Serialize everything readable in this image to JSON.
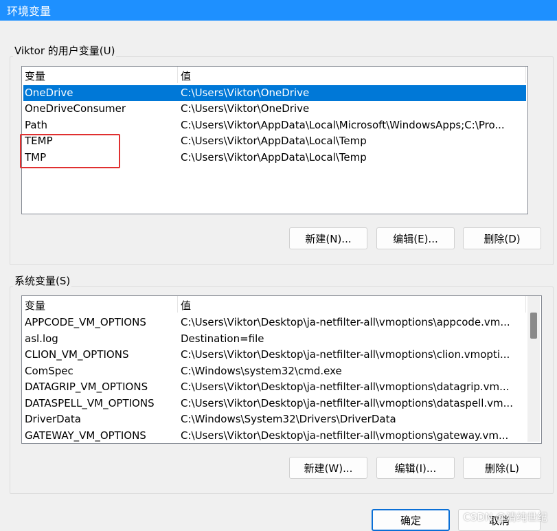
{
  "window": {
    "title": "环境变量"
  },
  "user_vars": {
    "label": "Viktor 的用户变量(U)",
    "columns": {
      "name": "变量",
      "value": "值"
    },
    "rows": [
      {
        "name": "OneDrive",
        "value": "C:\\Users\\Viktor\\OneDrive",
        "selected": true
      },
      {
        "name": "OneDriveConsumer",
        "value": "C:\\Users\\Viktor\\OneDrive"
      },
      {
        "name": "Path",
        "value": "C:\\Users\\Viktor\\AppData\\Local\\Microsoft\\WindowsApps;C:\\Pro..."
      },
      {
        "name": "TEMP",
        "value": "C:\\Users\\Viktor\\AppData\\Local\\Temp"
      },
      {
        "name": "TMP",
        "value": "C:\\Users\\Viktor\\AppData\\Local\\Temp"
      }
    ],
    "buttons": {
      "new": "新建(N)...",
      "edit": "编辑(E)...",
      "delete": "删除(D)"
    }
  },
  "system_vars": {
    "label": "系统变量(S)",
    "columns": {
      "name": "变量",
      "value": "值"
    },
    "rows": [
      {
        "name": "APPCODE_VM_OPTIONS",
        "value": "C:\\Users\\Viktor\\Desktop\\ja-netfilter-all\\vmoptions\\appcode.vm..."
      },
      {
        "name": "asl.log",
        "value": "Destination=file"
      },
      {
        "name": "CLION_VM_OPTIONS",
        "value": "C:\\Users\\Viktor\\Desktop\\ja-netfilter-all\\vmoptions\\clion.vmopti..."
      },
      {
        "name": "ComSpec",
        "value": "C:\\Windows\\system32\\cmd.exe"
      },
      {
        "name": "DATAGRIP_VM_OPTIONS",
        "value": "C:\\Users\\Viktor\\Desktop\\ja-netfilter-all\\vmoptions\\datagrip.vm..."
      },
      {
        "name": "DATASPELL_VM_OPTIONS",
        "value": "C:\\Users\\Viktor\\Desktop\\ja-netfilter-all\\vmoptions\\dataspell.vm..."
      },
      {
        "name": "DriverData",
        "value": "C:\\Windows\\System32\\Drivers\\DriverData"
      },
      {
        "name": "GATEWAY_VM_OPTIONS",
        "value": "C:\\Users\\Viktor\\Desktop\\ja-netfilter-all\\vmoptions\\gateway.vm..."
      }
    ],
    "buttons": {
      "new": "新建(W)...",
      "edit": "编辑(I)...",
      "delete": "删除(L)"
    }
  },
  "footer": {
    "ok": "确定",
    "cancel": "取消"
  },
  "watermark": "CSDN @清纯世纪",
  "colors": {
    "titlebar": "#1e90ff",
    "selection": "#0078d7",
    "highlight_box": "#e03030"
  }
}
